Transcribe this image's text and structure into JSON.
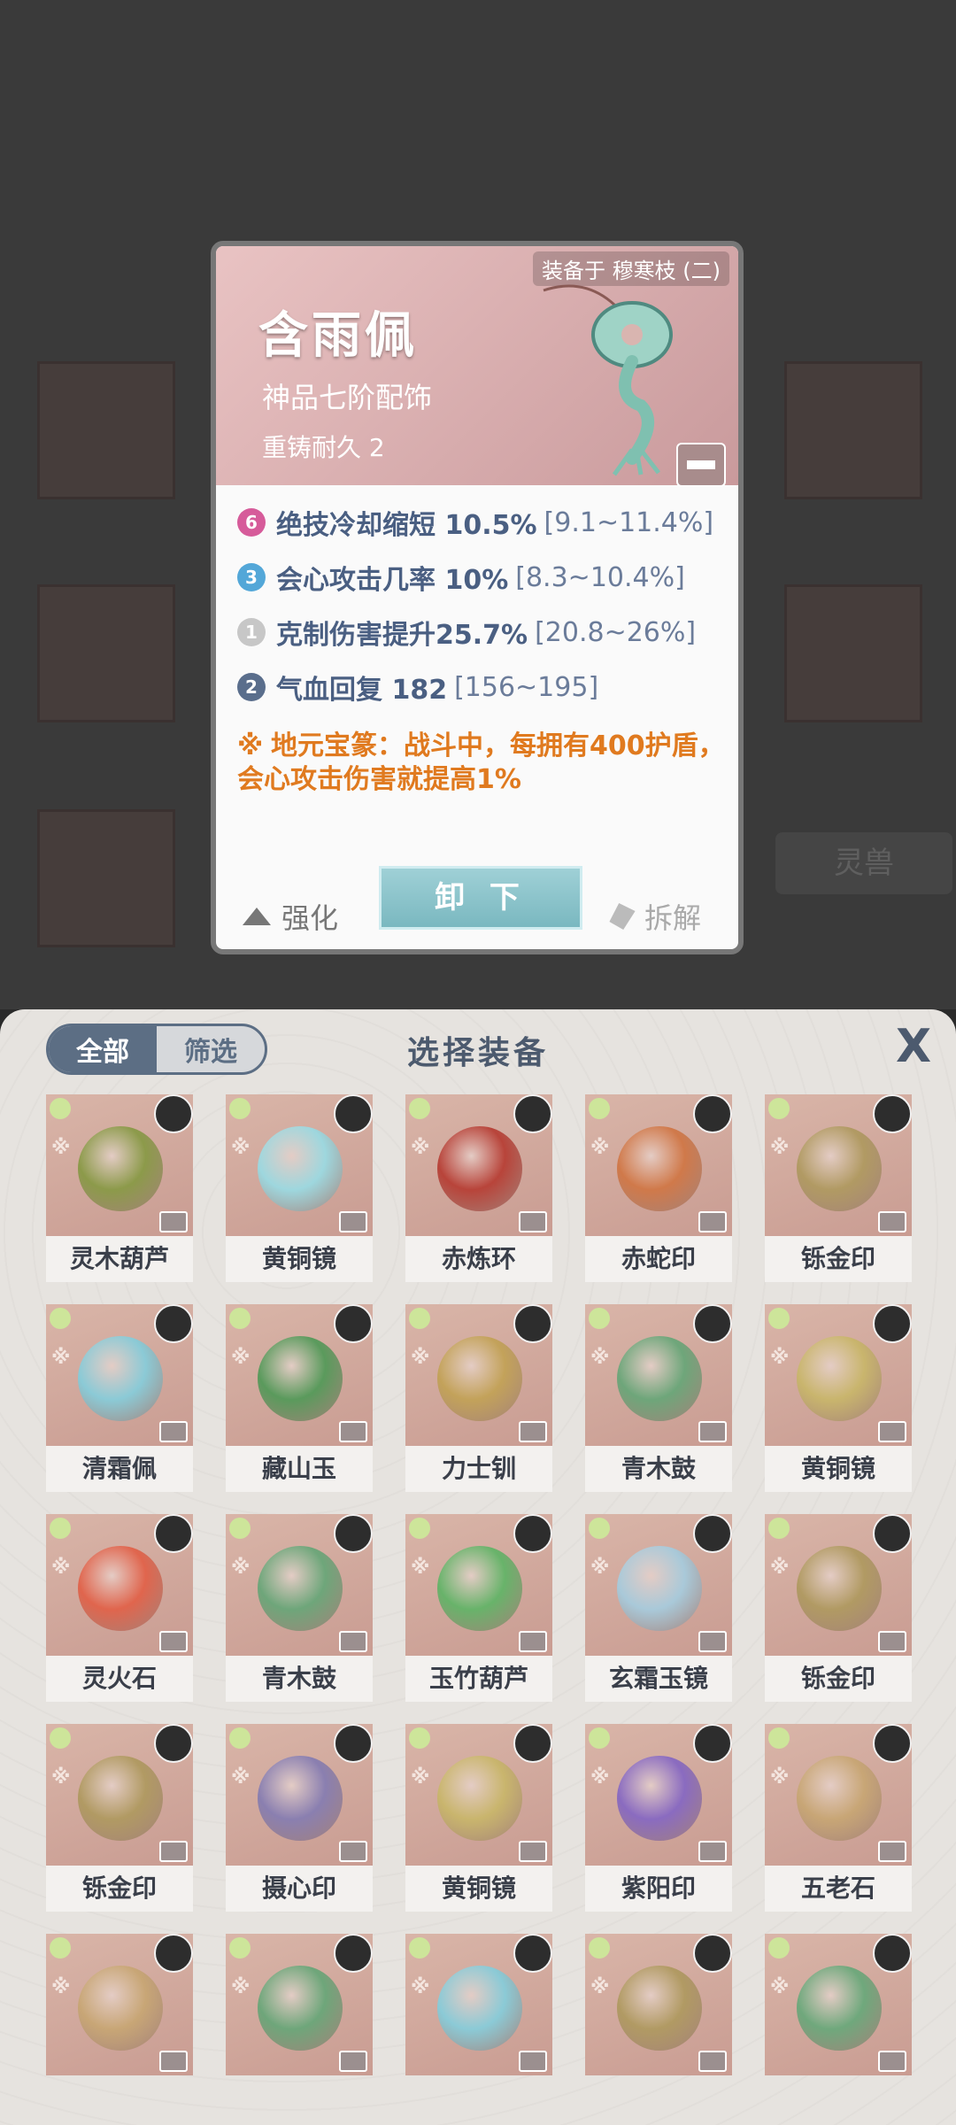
{
  "detail": {
    "equipped_label": "装备于 穆寒枝 (二)",
    "name": "含雨佩",
    "grade": "神品七阶配饰",
    "durability": "重铸耐久 2",
    "stats": [
      {
        "badge": "6",
        "badge_color": "#d65b9a",
        "name": "绝技冷却缩短 10.5%",
        "range": "[9.1~11.4%]"
      },
      {
        "badge": "3",
        "badge_color": "#53a7d8",
        "name": "会心攻击几率 10%",
        "range": "[8.3~10.4%]"
      },
      {
        "badge": "1",
        "badge_color": "#c7c7c7",
        "name": "克制伤害提升25.7%",
        "range": "[20.8~26%]"
      },
      {
        "badge": "2",
        "badge_color": "#5a6e8c",
        "name": "气血回复 182",
        "range": "[156~195]"
      }
    ],
    "special_effect": "地元宝篆：战斗中，每拥有400护盾，会心攻击伤害就提高1%",
    "strengthen_label": "强化",
    "unequip_label": "卸 下",
    "dismantle_label": "拆解"
  },
  "background": {
    "tag_label": "灵兽"
  },
  "panel": {
    "tabs": [
      {
        "label": "全部"
      },
      {
        "label": "筛选"
      }
    ],
    "title": "选择装备",
    "close_label": "X"
  },
  "items": [
    {
      "name": "灵木葫芦",
      "color": "#8c9a4a"
    },
    {
      "name": "黄铜镜",
      "color": "#9ed7de"
    },
    {
      "name": "赤炼环",
      "color": "#b8443a"
    },
    {
      "name": "赤蛇印",
      "color": "#d0794a"
    },
    {
      "name": "铄金印",
      "color": "#b19a63"
    },
    {
      "name": "清霜佩",
      "color": "#8bcad6"
    },
    {
      "name": "藏山玉",
      "color": "#5a9a5c"
    },
    {
      "name": "力士钏",
      "color": "#c3a25a"
    },
    {
      "name": "青木鼓",
      "color": "#6ea67a"
    },
    {
      "name": "黄铜镜",
      "color": "#c9b56d"
    },
    {
      "name": "灵火石",
      "color": "#e0654d"
    },
    {
      "name": "青木鼓",
      "color": "#6ea67a"
    },
    {
      "name": "玉竹葫芦",
      "color": "#68b36a"
    },
    {
      "name": "玄霜玉镜",
      "color": "#a9c9d9"
    },
    {
      "name": "铄金印",
      "color": "#b19a63"
    },
    {
      "name": "铄金印",
      "color": "#b19a63"
    },
    {
      "name": "摄心印",
      "color": "#8a7fb0"
    },
    {
      "name": "黄铜镜",
      "color": "#c9b56d"
    },
    {
      "name": "紫阳印",
      "color": "#8a6bc0"
    },
    {
      "name": "五老石",
      "color": "#c8a676"
    },
    {
      "name": "",
      "color": "#c8a676"
    },
    {
      "name": "",
      "color": "#6ea67a"
    },
    {
      "name": "",
      "color": "#8bcad6"
    },
    {
      "name": "",
      "color": "#b19a63"
    },
    {
      "name": "",
      "color": "#6fa87c"
    }
  ]
}
